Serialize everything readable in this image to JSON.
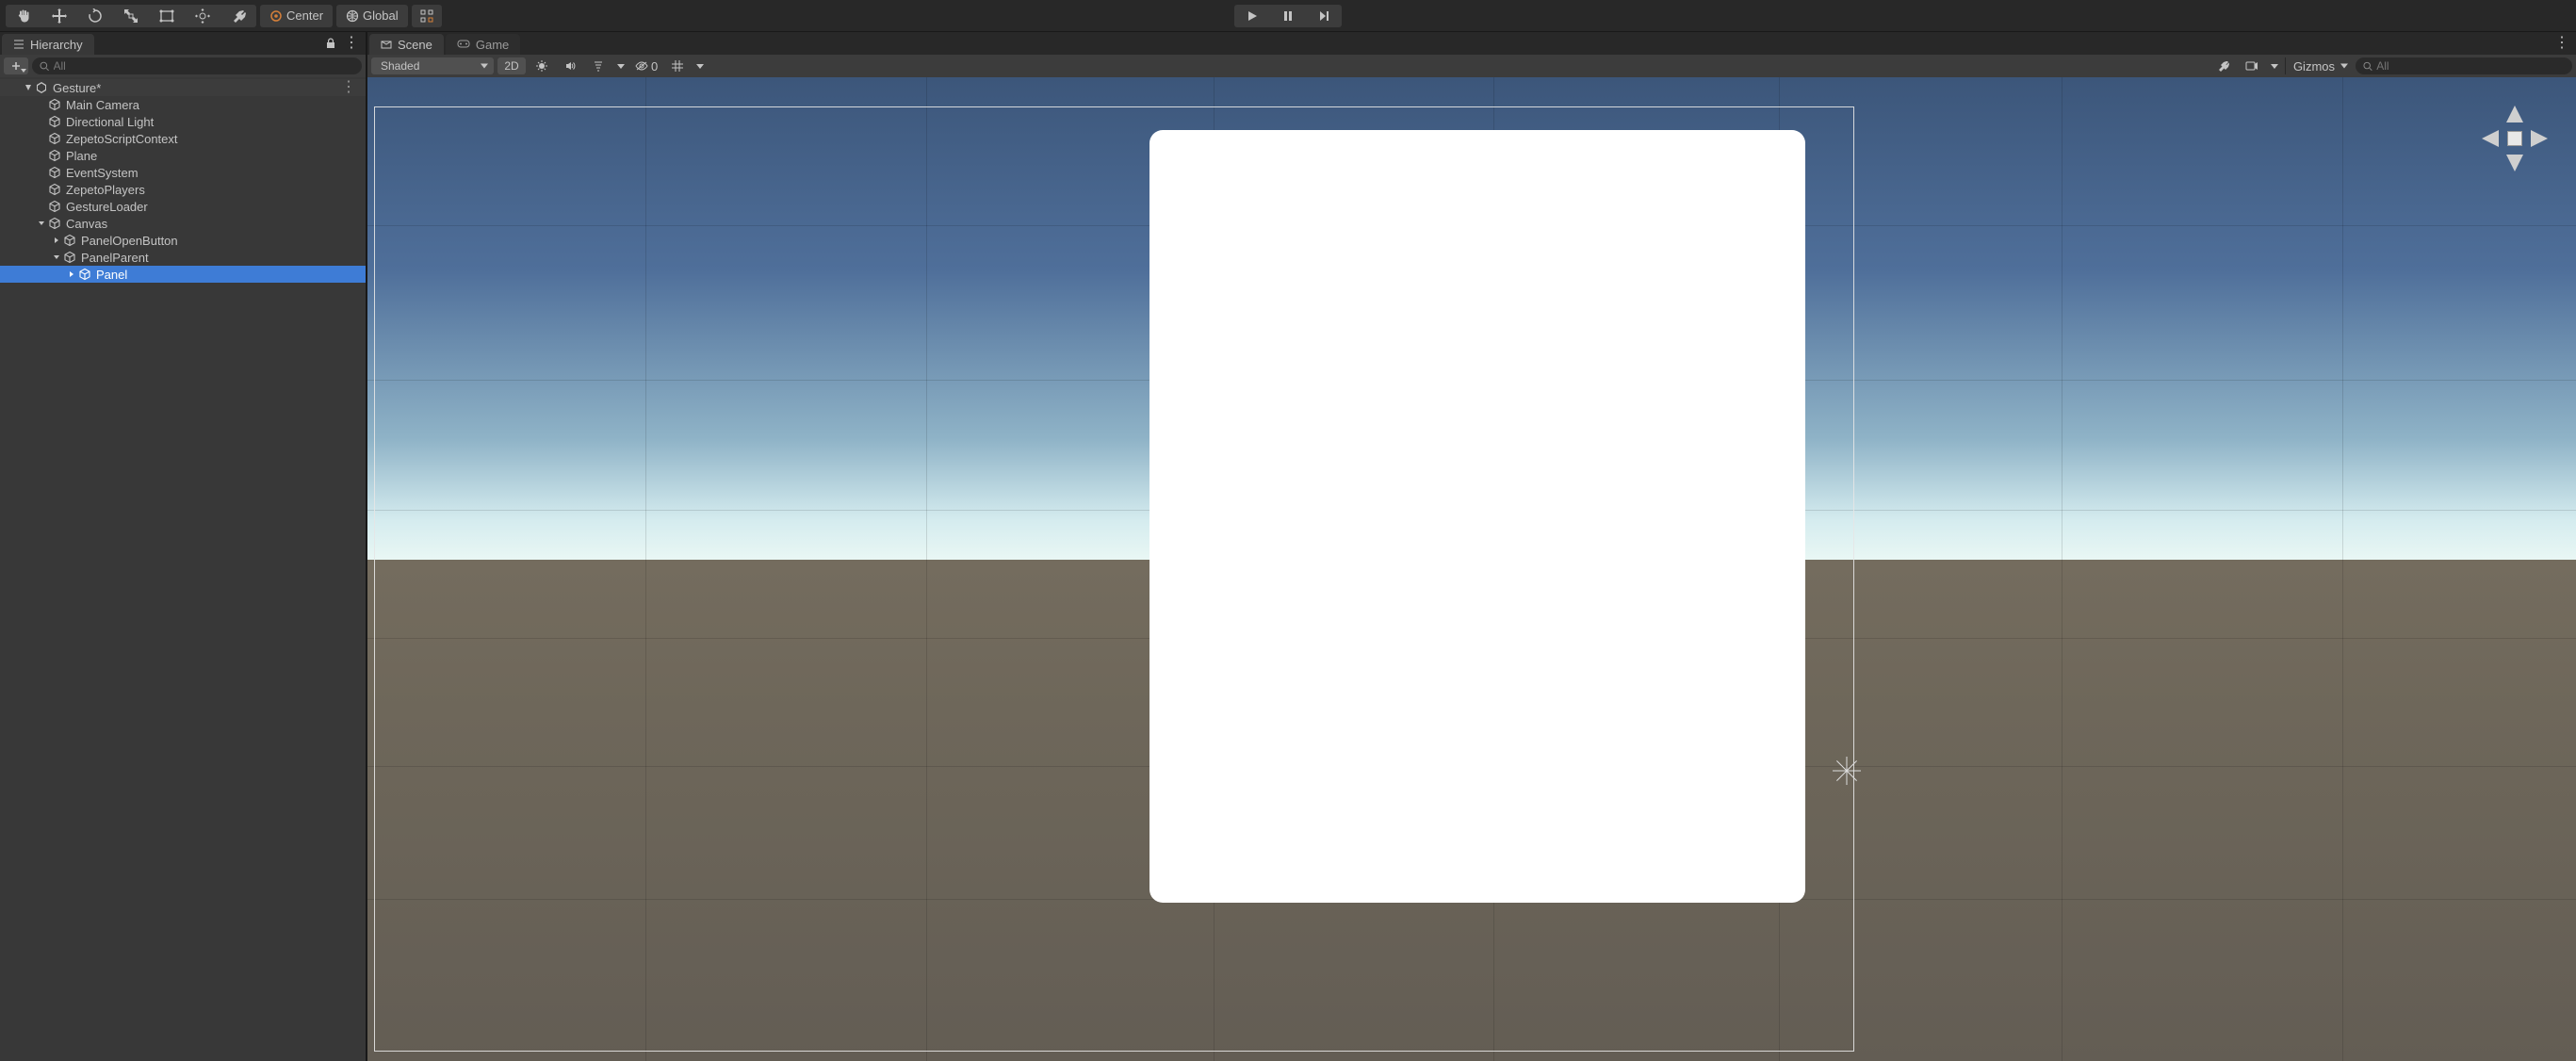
{
  "toolbar": {
    "pivot_label": "Center",
    "space_label": "Global"
  },
  "hierarchy": {
    "tab_label": "Hierarchy",
    "search_placeholder": "All",
    "scene_name": "Gesture*",
    "items": [
      {
        "label": "Main Camera",
        "depth": 1,
        "foldable": false
      },
      {
        "label": "Directional Light",
        "depth": 1,
        "foldable": false
      },
      {
        "label": "ZepetoScriptContext",
        "depth": 1,
        "foldable": false
      },
      {
        "label": "Plane",
        "depth": 1,
        "foldable": false
      },
      {
        "label": "EventSystem",
        "depth": 1,
        "foldable": false
      },
      {
        "label": "ZepetoPlayers",
        "depth": 1,
        "foldable": false
      },
      {
        "label": "GestureLoader",
        "depth": 1,
        "foldable": false
      },
      {
        "label": "Canvas",
        "depth": 1,
        "foldable": true,
        "expanded": true
      },
      {
        "label": "PanelOpenButton",
        "depth": 2,
        "foldable": true,
        "expanded": false
      },
      {
        "label": "PanelParent",
        "depth": 2,
        "foldable": true,
        "expanded": true
      },
      {
        "label": "Panel",
        "depth": 3,
        "foldable": true,
        "expanded": false,
        "selected": true
      }
    ]
  },
  "scene": {
    "tab_scene": "Scene",
    "tab_game": "Game",
    "shading_mode": "Shaded",
    "btn_2d": "2D",
    "hidden_count": "0",
    "gizmos_label": "Gizmos",
    "search_placeholder": "All"
  }
}
